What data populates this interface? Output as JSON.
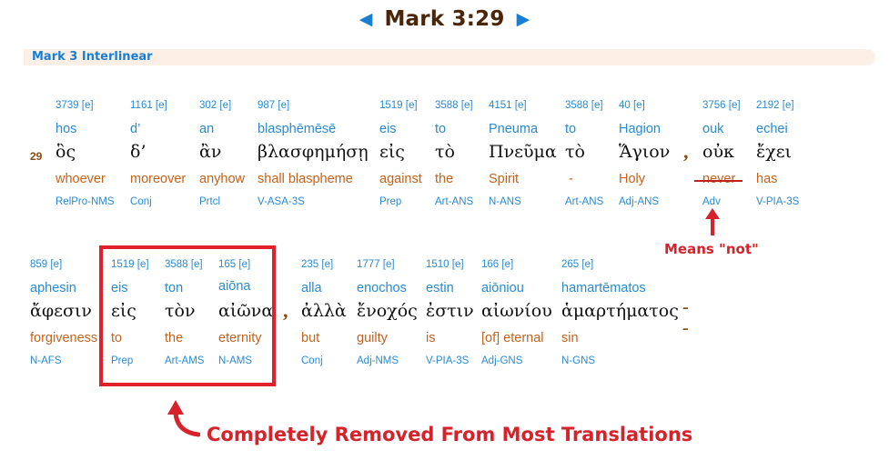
{
  "header": {
    "prev_icon": "triangle-left",
    "next_icon": "triangle-right",
    "title": "Mark 3:29"
  },
  "section": {
    "title": "Mark 3 Interlinear"
  },
  "verse": {
    "number": "29",
    "words": [
      {
        "strongs": "3739 [e]",
        "translit": "hos",
        "greek": "ὃς",
        "english": "whoever",
        "parse": "RelPro-NMS"
      },
      {
        "strongs": "1161 [e]",
        "translit": "d’",
        "greek": "δ’",
        "english": "moreover",
        "parse": "Conj"
      },
      {
        "strongs": "302 [e]",
        "translit": "an",
        "greek": "ἂν",
        "english": "anyhow",
        "parse": "Prtcl"
      },
      {
        "strongs": "987 [e]",
        "translit": "blasphēmēsē",
        "greek": "βλασφημήσῃ",
        "english": "shall blaspheme",
        "parse": "V-ASA-3S"
      },
      {
        "strongs": "1519 [e]",
        "translit": "eis",
        "greek": "εἰς",
        "english": "against",
        "parse": "Prep"
      },
      {
        "strongs": "3588 [e]",
        "translit": "to",
        "greek": "τὸ",
        "english": "the",
        "parse": "Art-ANS"
      },
      {
        "strongs": "4151 [e]",
        "translit": "Pneuma",
        "greek": "Πνεῦμα",
        "english": "Spirit",
        "parse": "N-ANS"
      },
      {
        "strongs": "3588 [e]",
        "translit": "to",
        "greek": "τὸ",
        "english": "-",
        "parse": "Art-ANS"
      },
      {
        "strongs": "40 [e]",
        "translit": "Hagion",
        "greek": "Ἅγιον",
        "english": "Holy",
        "parse": "Adj-ANS"
      },
      {
        "strongs": "3756 [e]",
        "translit": "ouk",
        "greek": "οὐκ",
        "english": "never",
        "parse": "Adv",
        "struck": true
      },
      {
        "strongs": "2192 [e]",
        "translit": "echei",
        "greek": "ἔχει",
        "english": "has",
        "parse": "V-PIA-3S"
      },
      {
        "strongs": "859 [e]",
        "translit": "aphesin",
        "greek": "ἄφεσιν",
        "english": "forgiveness",
        "parse": "N-AFS"
      },
      {
        "strongs": "1519 [e]",
        "translit": "eis",
        "greek": "εἰς",
        "english": "to",
        "parse": "Prep"
      },
      {
        "strongs": "3588 [e]",
        "translit": "ton",
        "greek": "τὸν",
        "english": "the",
        "parse": "Art-AMS"
      },
      {
        "strongs": "165 [e]",
        "translit": "aiōna",
        "greek": "αἰῶνα",
        "english": "eternity",
        "parse": "N-AMS"
      },
      {
        "strongs": "235 [e]",
        "translit": "alla",
        "greek": "ἀλλὰ",
        "english": "but",
        "parse": "Conj"
      },
      {
        "strongs": "1777 [e]",
        "translit": "enochos",
        "greek": "ἔνοχός",
        "english": "guilty",
        "parse": "Adj-NMS"
      },
      {
        "strongs": "1510 [e]",
        "translit": "estin",
        "greek": "ἐστιν",
        "english": "is",
        "parse": "V-PIA-3S"
      },
      {
        "strongs": "166 [e]",
        "translit": "aiōniou",
        "greek": "αἰωνίου",
        "english": "[of] eternal",
        "parse": "Adj-GNS"
      },
      {
        "strongs": "265 [e]",
        "translit": "hamartēmatos",
        "greek": "ἁμαρτήματος",
        "english": "sin",
        "parse": "N-GNS"
      }
    ],
    "punctuation": {
      "comma_1": ",",
      "comma_2": ",",
      "dash": "--"
    }
  },
  "annotations": {
    "means_not": "Means \"not\"",
    "removed": "Completely Removed From Most Translations",
    "color": "#d6232b"
  },
  "colors": {
    "title": "#4a2508",
    "link_blue": "#2a8ad0",
    "english_orange": "#c4621d",
    "section_bg": "#fcefe6"
  }
}
